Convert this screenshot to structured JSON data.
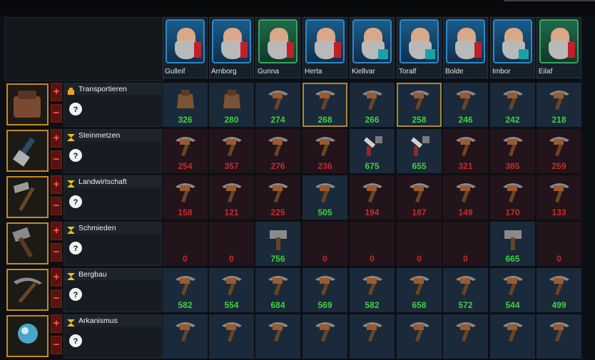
{
  "workers": [
    {
      "name": "Gulleif",
      "status": "red"
    },
    {
      "name": "Arnborg",
      "status": "red"
    },
    {
      "name": "Gunna",
      "status": "green"
    },
    {
      "name": "Herta",
      "status": "red"
    },
    {
      "name": "Kiellvar",
      "status": "teal"
    },
    {
      "name": "Toralf",
      "status": "teal"
    },
    {
      "name": "Bolde",
      "status": "red"
    },
    {
      "name": "Imbor",
      "status": "teal"
    },
    {
      "name": "Eilaf",
      "status": "green"
    }
  ],
  "jobs": [
    {
      "title": "Transportieren",
      "icon": "satchel-icon",
      "header_icon": "bag-icon",
      "cell_bg": "#1b2a3a",
      "values": [
        326,
        280,
        274,
        268,
        266,
        258,
        246,
        242,
        218
      ],
      "value_color": "green",
      "cell_icons": [
        "sack-icon",
        "sack-icon",
        "pickaxe-icon",
        "pickaxe-icon",
        "pickaxe-icon",
        "pickaxe-icon",
        "pickaxe-icon",
        "pickaxe-icon",
        "pickaxe-icon"
      ],
      "highlight": [
        3,
        5
      ]
    },
    {
      "title": "Steinmetzen",
      "icon": "chisel-icon",
      "header_icon": "hourglass-icon",
      "cell_bg": "#22141a",
      "values": [
        254,
        357,
        276,
        236,
        675,
        655,
        321,
        385,
        259
      ],
      "value_color": "mixed",
      "good": [
        4,
        5
      ],
      "cell_icons": [
        "pickaxe-icon",
        "pickaxe-icon",
        "pickaxe-icon",
        "pickaxe-icon",
        "chisel-tool-icon",
        "chisel-tool-icon",
        "pickaxe-icon",
        "pickaxe-icon",
        "pickaxe-icon"
      ],
      "highlight": []
    },
    {
      "title": "Landwirtschaft",
      "icon": "rake-icon",
      "header_icon": "hourglass-icon",
      "cell_bg": "#22141a",
      "values": [
        158,
        121,
        225,
        505,
        194,
        187,
        149,
        170,
        133
      ],
      "value_color": "mixed",
      "good": [
        3
      ],
      "cell_icons": [
        "pickaxe-icon",
        "pickaxe-icon",
        "pickaxe-icon",
        "rake-tool-icon",
        "pickaxe-icon",
        "pickaxe-icon",
        "pickaxe-icon",
        "pickaxe-icon",
        "pickaxe-icon"
      ],
      "highlight": []
    },
    {
      "title": "Schmieden",
      "icon": "hammer-icon",
      "header_icon": "hourglass-icon",
      "cell_bg": "#22141a",
      "values": [
        0,
        0,
        756,
        0,
        0,
        0,
        0,
        665,
        0
      ],
      "value_color": "mixed",
      "good": [
        2,
        7
      ],
      "cell_icons": [
        "",
        "",
        "hammer-tool-icon",
        "",
        "",
        "",
        "",
        "hammer-tool-icon",
        ""
      ],
      "highlight": []
    },
    {
      "title": "Bergbau",
      "icon": "pickaxe-icon",
      "header_icon": "hourglass-icon",
      "cell_bg": "#1b2a3a",
      "values": [
        582,
        554,
        684,
        569,
        582,
        658,
        572,
        544,
        499
      ],
      "value_color": "green",
      "cell_icons": [
        "pickaxe-icon",
        "pickaxe-icon",
        "pickaxe-icon",
        "pickaxe-icon",
        "pickaxe-icon",
        "pickaxe-icon",
        "pickaxe-icon",
        "pickaxe-icon",
        "pickaxe-icon"
      ],
      "highlight": []
    },
    {
      "title": "Arkanismus",
      "icon": "orb-icon",
      "header_icon": "hourglass-icon",
      "cell_bg": "#1b2a3a",
      "values": [],
      "value_color": "green",
      "cell_icons": [
        "pickaxe-icon",
        "pickaxe-icon",
        "pickaxe-icon",
        "pickaxe-icon",
        "pickaxe-icon",
        "pickaxe-icon",
        "pickaxe-icon",
        "pickaxe-icon",
        "pickaxe-icon"
      ],
      "highlight": []
    }
  ],
  "plus_label": "+",
  "minus_label": "−",
  "colors": {
    "good": "#3fd23f",
    "bad": "#c52c2c",
    "accent": "#c58a1e"
  }
}
